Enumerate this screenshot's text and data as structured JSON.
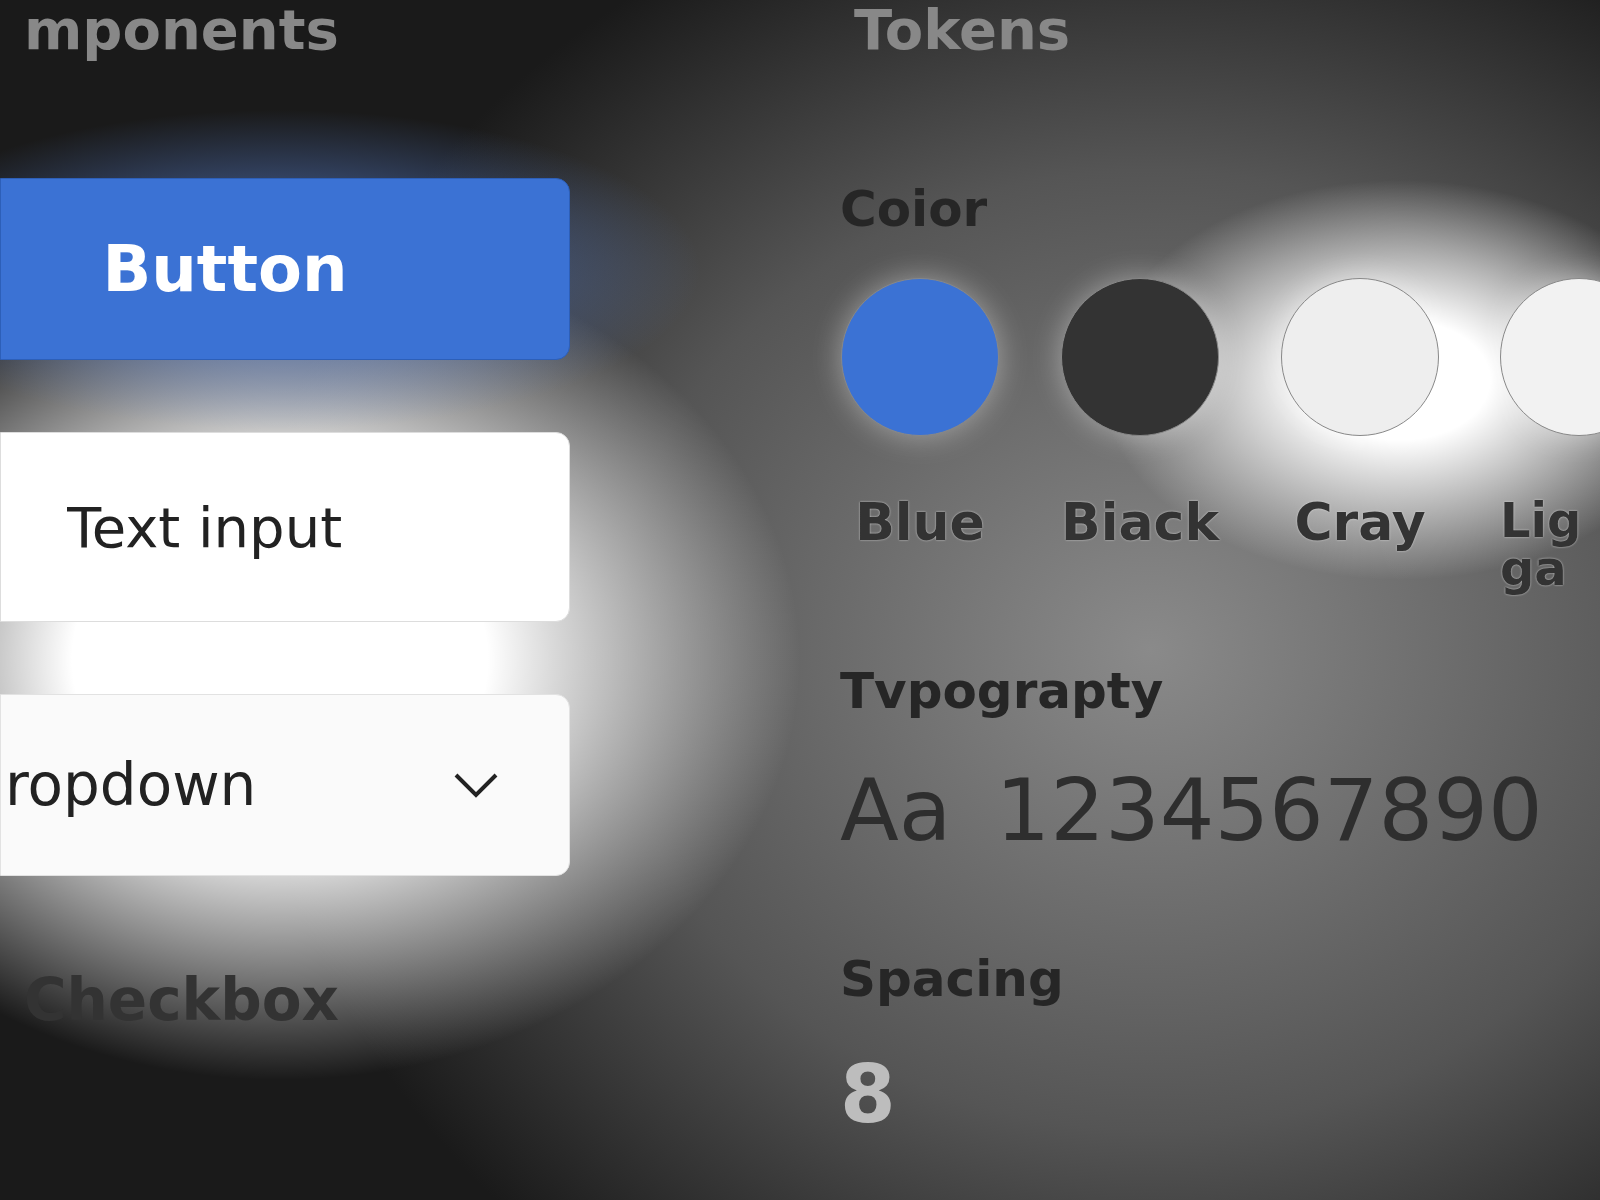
{
  "components": {
    "title": "mponents",
    "button": {
      "label": "Button"
    },
    "text_input": {
      "placeholder": "Text input"
    },
    "dropdown": {
      "value": "ropdown"
    },
    "checkbox": {
      "label": "Checkbox"
    }
  },
  "tokens": {
    "title": "Tokens",
    "color": {
      "title": "Coior",
      "swatches": [
        {
          "label": "Blue",
          "color": "#3b72d4"
        },
        {
          "label": "Biack",
          "color": "#333333"
        },
        {
          "label": "Cray",
          "color": "#eeeeee"
        },
        {
          "label": "Lig ga",
          "color": "#f2f2f2"
        }
      ]
    },
    "typography": {
      "title": "Tvpograpty",
      "sample": "Aa",
      "digits": "1234567890"
    },
    "spacing": {
      "title": "Spacing",
      "value": "8"
    }
  }
}
